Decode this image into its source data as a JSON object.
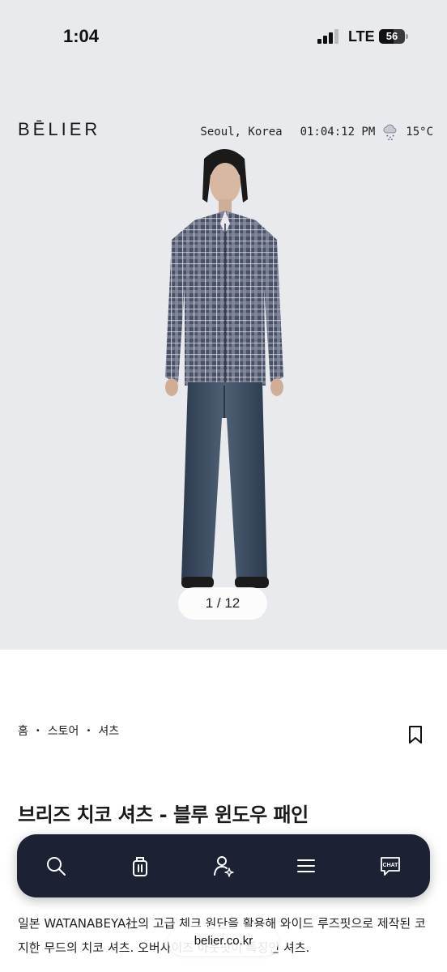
{
  "status_bar": {
    "time": "1:04",
    "network": "LTE",
    "battery": "56",
    "battery_level_percent": 56,
    "signal_bars_active": 3,
    "signal_bars_total": 4
  },
  "header": {
    "brand": "BĒLIER",
    "location": "Seoul, Korea",
    "clock": "01:04:12 PM",
    "weather_icon": "snow-cloud-icon",
    "temperature": "15°C"
  },
  "gallery": {
    "pager": "1 / 12"
  },
  "breadcrumb": {
    "items": [
      "홈",
      "스토어",
      "셔츠"
    ],
    "separator": "•"
  },
  "product": {
    "title": "브리즈 치코 셔츠 - 블루 윈도우 패인",
    "description": "일본 WATANABEYA社의 고급 체크 원단을 활용해 와이드 루즈핏으로 제작된 코지한 무드의 치코 셔츠. 오버사이즈 아웃핏이 특징인 셔츠."
  },
  "bottom_nav": {
    "items": [
      {
        "name": "search",
        "icon": "search-icon"
      },
      {
        "name": "cart",
        "icon": "shopping-bag-icon"
      },
      {
        "name": "account",
        "icon": "user-sparkle-icon"
      },
      {
        "name": "menu",
        "icon": "menu-icon"
      },
      {
        "name": "chat",
        "icon": "chat-icon",
        "label": "CHAT"
      }
    ]
  },
  "browser": {
    "url": "belier.co.kr"
  },
  "colors": {
    "background": "#e8eaed",
    "nav_bg": "#1c2133",
    "nav_icon": "#ffffff",
    "text": "#1a1a1a"
  }
}
